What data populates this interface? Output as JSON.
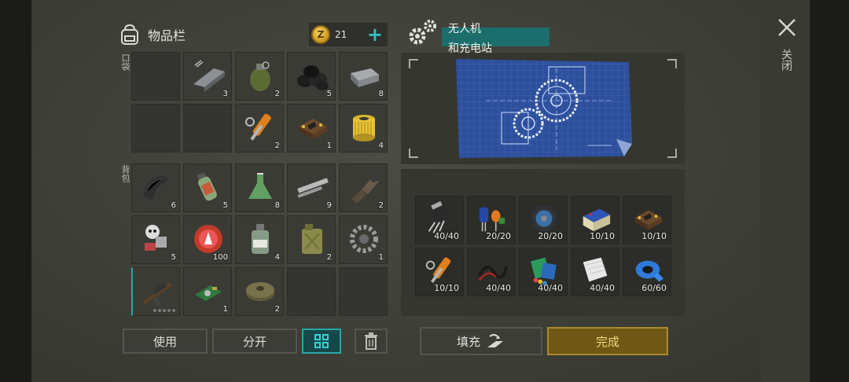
{
  "inventory": {
    "title": "物品栏",
    "coins": "21",
    "add_symbol": "+",
    "pocket_label": "口袋",
    "backpack_label": "背包"
  },
  "pockets": [
    {
      "icon": "empty",
      "qty": ""
    },
    {
      "icon": "metal-bar-icon",
      "qty": "3"
    },
    {
      "icon": "grenade-icon",
      "qty": "2"
    },
    {
      "icon": "coal-icon",
      "qty": "5"
    },
    {
      "icon": "iron-ingot-icon",
      "qty": "8"
    },
    {
      "icon": "empty",
      "qty": ""
    },
    {
      "icon": "empty",
      "qty": ""
    },
    {
      "icon": "hydraulic-cylinder-icon",
      "qty": "2"
    },
    {
      "icon": "circuit-board-icon",
      "qty": "1"
    },
    {
      "icon": "oil-filter-icon",
      "qty": "4"
    }
  ],
  "backpack": [
    {
      "icon": "rubber-sheet-icon",
      "qty": "6"
    },
    {
      "icon": "cocktail-jar-icon",
      "qty": "5"
    },
    {
      "icon": "flask-icon",
      "qty": "8"
    },
    {
      "icon": "metal-pipe-icon",
      "qty": "9"
    },
    {
      "icon": "pipe-fitting-icon",
      "qty": "2"
    },
    {
      "icon": "robot-scrap-icon",
      "qty": "5"
    },
    {
      "icon": "bottle-cap-icon",
      "qty": "100"
    },
    {
      "icon": "bottle-icon",
      "qty": "4"
    },
    {
      "icon": "jerrycan-icon",
      "qty": "2"
    },
    {
      "icon": "gear-icon",
      "qty": "1"
    },
    {
      "icon": "rifle-icon",
      "qty": ""
    },
    {
      "icon": "pcb-icon",
      "qty": "1"
    },
    {
      "icon": "landmine-icon",
      "qty": "2"
    },
    {
      "icon": "empty",
      "qty": ""
    },
    {
      "icon": "empty",
      "qty": ""
    }
  ],
  "buttons": {
    "use": "使用",
    "split": "分开",
    "fill": "填充",
    "done": "完成"
  },
  "craft": {
    "name_line1": "无人机",
    "name_line2": "和充电站"
  },
  "requirements": [
    {
      "icon": "transistor-icon",
      "qty": "40/40"
    },
    {
      "icon": "capacitor-icon",
      "qty": "20/20"
    },
    {
      "icon": "wire-spool-icon",
      "qty": "20/20"
    },
    {
      "icon": "battery-icon",
      "qty": "10/10"
    },
    {
      "icon": "circuit-board-icon",
      "qty": "10/10"
    },
    {
      "icon": "hydraulic-cylinder-icon",
      "qty": "10/10"
    },
    {
      "icon": "cables-icon",
      "qty": "40/40"
    },
    {
      "icon": "plastic-icon",
      "qty": "40/40"
    },
    {
      "icon": "foil-icon",
      "qty": "40/40"
    },
    {
      "icon": "duct-tape-icon",
      "qty": "60/60"
    }
  ],
  "close_label": "关闭",
  "colors": {
    "accent": "#2fc1c5",
    "done_button": "#6f5814",
    "craft_name_bar": "#1c6e6d"
  }
}
